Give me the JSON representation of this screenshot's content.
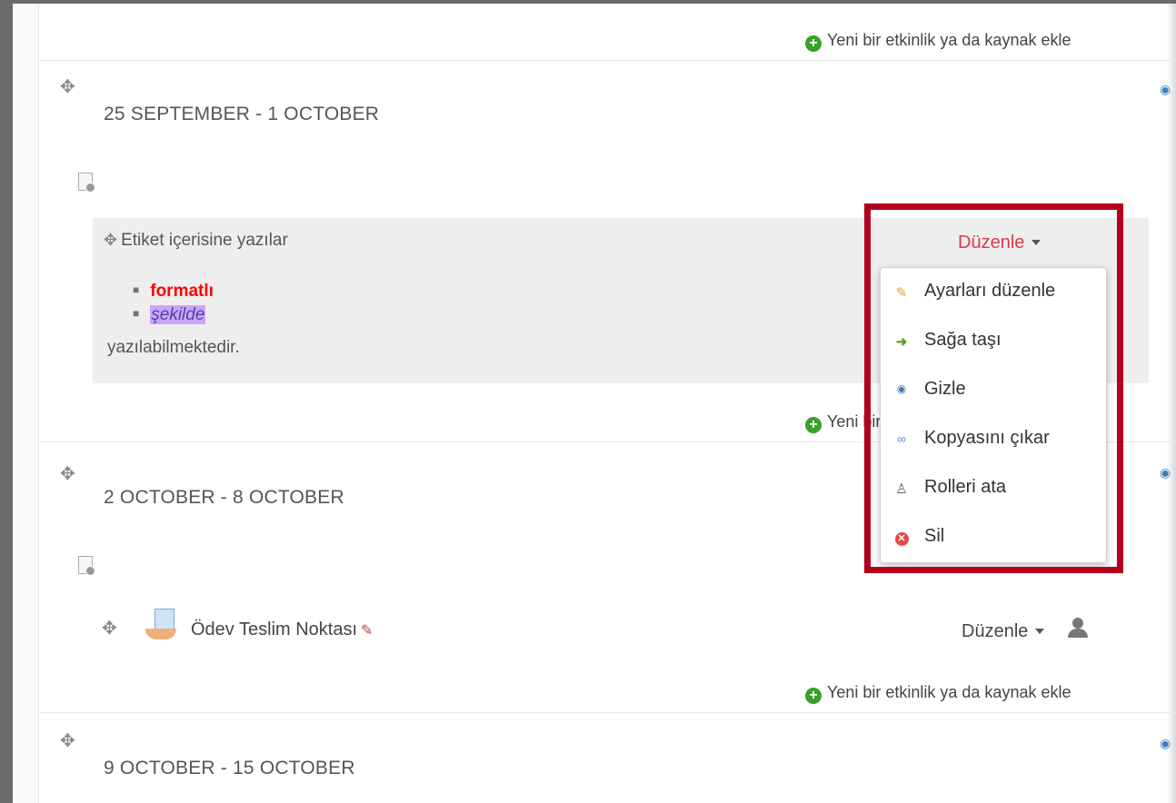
{
  "add_activity_label": "Yeni bir etkinlik ya da kaynak ekle",
  "sections": [
    {
      "title": "25 SEPTEMBER - 1 OCTOBER"
    },
    {
      "title": "2 OCTOBER - 8 OCTOBER"
    },
    {
      "title": "9 OCTOBER - 15 OCTOBER"
    }
  ],
  "label_module": {
    "title": "Etiket içerisine yazılar",
    "list_items": [
      "formatlı",
      "şekilde"
    ],
    "trailing_text": "yazılabilmektedir."
  },
  "edit_label": "Düzenle",
  "edit_menu": {
    "items": [
      {
        "label": "Ayarları düzenle",
        "icon": "pencil-icon"
      },
      {
        "label": "Sağa taşı",
        "icon": "arrow-right-icon"
      },
      {
        "label": "Gizle",
        "icon": "eye-icon"
      },
      {
        "label": "Kopyasını çıkar",
        "icon": "duplicate-icon"
      },
      {
        "label": "Rolleri ata",
        "icon": "assign-roles-icon"
      },
      {
        "label": "Sil",
        "icon": "delete-icon"
      }
    ]
  },
  "assignment": {
    "title": "Ödev Teslim Noktası"
  },
  "colors": {
    "highlight_box": "#b3001b",
    "edit_active": "#e0364a",
    "formatted_text": "#ff0000",
    "italic_highlight_bg": "#c9a6ff",
    "add_icon": "#3aa02b"
  }
}
